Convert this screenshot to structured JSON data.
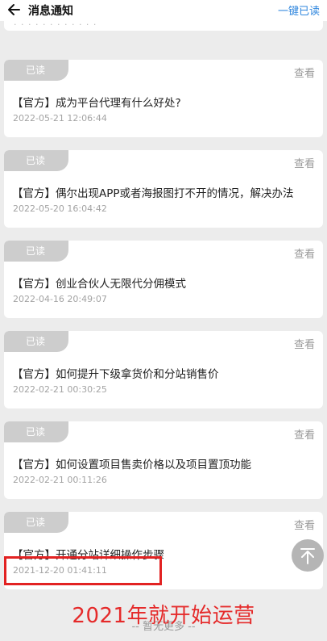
{
  "header": {
    "title": "消息通知",
    "read_all_label": "一键已读",
    "back_icon": "back-arrow-icon"
  },
  "notices": [
    {
      "badge": "已读",
      "view": "查看",
      "title": "【官方】成为平台代理有什么好处?",
      "date": "2022-05-21 12:06:44"
    },
    {
      "badge": "已读",
      "view": "查看",
      "title": "【官方】偶尔出现APP或者海报图打不开的情况，解决办法",
      "date": "2022-05-20 16:04:42"
    },
    {
      "badge": "已读",
      "view": "查看",
      "title": "【官方】创业合伙人无限代分佣模式",
      "date": "2022-04-16 20:49:07"
    },
    {
      "badge": "已读",
      "view": "查看",
      "title": "【官方】如何提升下级拿货价和分站销售价",
      "date": "2022-02-21 00:30:25"
    },
    {
      "badge": "已读",
      "view": "查看",
      "title": "【官方】如何设置项目售卖价格以及项目置顶功能",
      "date": "2022-02-21 00:11:26"
    },
    {
      "badge": "已读",
      "view": "查看",
      "title": "【官方】开通分站详细操作步骤",
      "date": "2021-12-20 01:41:11"
    }
  ],
  "annotation": "2021年就开始运营",
  "footer": "-- 暂无更多 --",
  "colors": {
    "accent": "#2e86de",
    "badge": "#cdcdcd",
    "highlight": "#e22222"
  }
}
